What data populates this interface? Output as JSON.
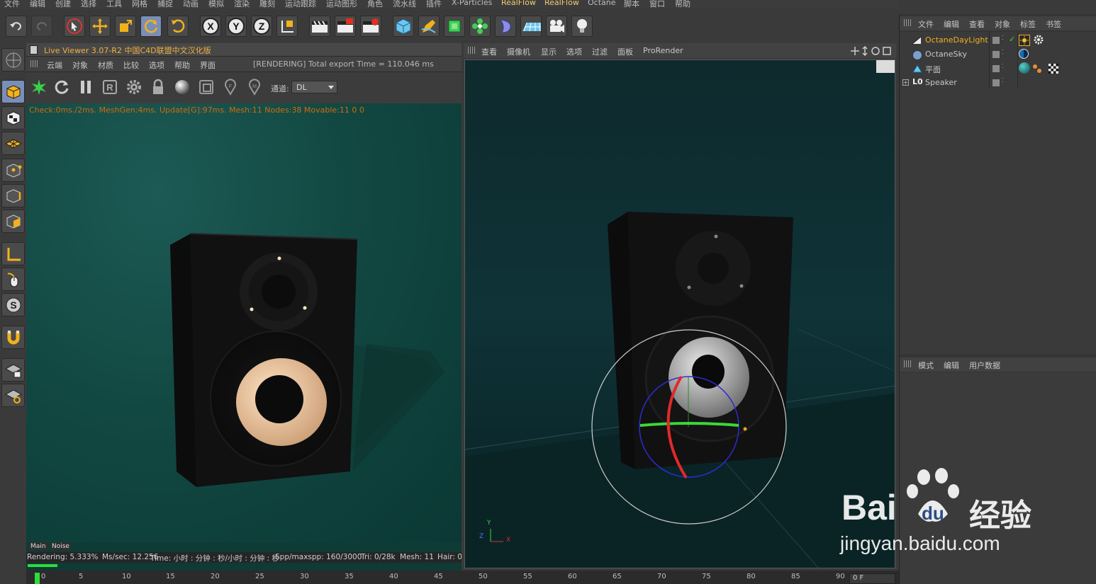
{
  "menubar": {
    "items": [
      "文件",
      "编辑",
      "创建",
      "选择",
      "工具",
      "网格",
      "捕捉",
      "动画",
      "模拟",
      "渲染",
      "雕刻",
      "运动跟踪",
      "运动图形",
      "角色",
      "流水线",
      "插件",
      "X-Particles",
      "RealFlow",
      "RealFlow",
      "Octane",
      "脚本",
      "窗口",
      "帮助"
    ]
  },
  "icons": {
    "toolbar": [
      "undo-icon",
      "redo-icon",
      "live-select-icon",
      "move-icon",
      "scale-icon",
      "rotate-icon",
      "recent-tool-icon",
      "x-axis-icon",
      "y-axis-icon",
      "z-axis-icon",
      "coordinate-system-icon",
      "render-view-icon",
      "render-picture-viewer-icon",
      "render-settings-icon",
      "cube-icon",
      "pen-icon",
      "subdivision-icon",
      "cloner-icon",
      "deformer-icon",
      "floor-icon",
      "camera-icon",
      "light-icon"
    ],
    "left": [
      "make-editable-icon",
      "model-mode-icon",
      "texture-mode-icon",
      "workplane-icon",
      "points-mode-icon",
      "edges-mode-icon",
      "polygons-mode-icon",
      "axis-mode-icon",
      "tweak-icon",
      "snap-icon",
      "magnet-icon",
      "workplane-lock-icon",
      "locked-workplane-icon"
    ]
  },
  "live_viewer": {
    "title": "Live Viewer 3.07-R2 中国C4D联盟中文汉化版",
    "menu": [
      "云端",
      "对象",
      "材质",
      "比较",
      "选项",
      "帮助",
      "界面"
    ],
    "status": "[RENDERING] Total export Time = 110.046 ms",
    "channel_label": "通道:",
    "channel_value": "DL",
    "info": "Check:0ms./2ms. MeshGen:4ms. Update[G]:97ms. Mesh:11 Nodes:38 Movable:11  0 0",
    "pass_tabs": [
      "Main",
      "Noise"
    ],
    "render_status": {
      "rendering": "Rendering: 5.333%",
      "ms_sec": "Ms/sec: 12.256",
      "time": "Time: 小时 : 分钟 : 秒/小时 : 分钟 : 秒",
      "spp": "Spp/maxspp: 160/3000",
      "tri": "Tri: 0/28k",
      "mesh": "Mesh: 11",
      "hair": "Hair: 0"
    },
    "progress": 0.05333
  },
  "viewport": {
    "menu": [
      "查看",
      "摄像机",
      "显示",
      "选项",
      "过滤",
      "面板",
      "ProRender"
    ],
    "axis_labels": {
      "y": "Y",
      "z": "Z",
      "x": "X"
    }
  },
  "object_manager": {
    "menu": [
      "文件",
      "编辑",
      "查看",
      "对象",
      "标签",
      "书签"
    ],
    "objects": [
      {
        "name": "OctaneDayLight",
        "color": "#f0b020",
        "selected": true
      },
      {
        "name": "OctaneSky",
        "color": "#c8c8c8",
        "selected": false
      },
      {
        "name": "平面",
        "color": "#c8c8c8",
        "selected": false
      },
      {
        "name": "Speaker",
        "color": "#c8c8c8",
        "selected": false
      }
    ]
  },
  "attributes": {
    "menu": [
      "模式",
      "编辑",
      "用户数据"
    ]
  },
  "timeline": {
    "ticks": [
      "0",
      "5",
      "10",
      "15",
      "20",
      "25",
      "30",
      "35",
      "40",
      "45",
      "50",
      "55",
      "60",
      "65",
      "70",
      "75",
      "80",
      "85",
      "90"
    ],
    "current_frame": "0 F"
  },
  "watermark": {
    "brand": "Bai",
    "brand2": "du",
    "cn": "经验",
    "url": "jingyan.baidu.com"
  },
  "colors": {
    "accent_orange": "#f0b040",
    "selection_blue": "#7a8fb8",
    "progress_green": "#2edc3a"
  }
}
